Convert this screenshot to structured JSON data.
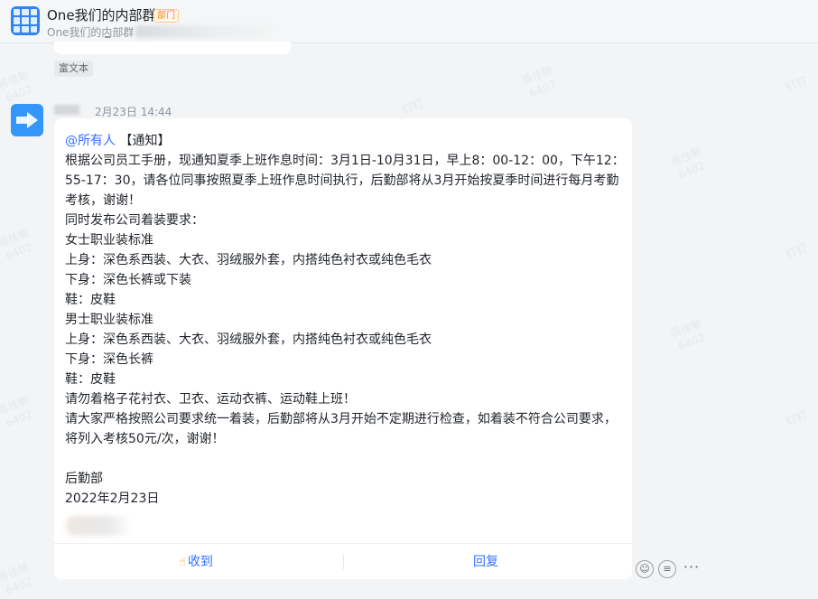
{
  "header": {
    "title": "One我们的内部群",
    "dept_tag": "部门",
    "subtitle": "One我们的内部群"
  },
  "prev_message": {
    "rich_text_tag": "富文本"
  },
  "message": {
    "time": "2月23日 14:44",
    "mention": "@所有人",
    "notice_title": "【通知】",
    "lines": [
      "根据公司员工手册，现通知夏季上班作息时间：3月1日-10月31日，早上8：00-12：00，下午12：",
      "55-17：30，请各位同事按照夏季上班作息时间执行，后勤部将从3月开始按夏季时间进行每月考勤",
      "考核，谢谢！",
      "同时发布公司着装要求：",
      "女士职业装标准",
      "上身：深色系西装、大衣、羽绒服外套，内搭纯色衬衣或纯色毛衣",
      "下身：深色长裤或下装",
      "鞋：皮鞋",
      "男士职业装标准",
      "上身：深色系西装、大衣、羽绒服外套，内搭纯色衬衣或纯色毛衣",
      "下身：深色长裤",
      "鞋：皮鞋",
      "请勿着格子花衬衣、卫衣、运动衣裤、运动鞋上班！",
      "请大家严格按照公司要求统一着装，后勤部将从3月开始不定期进行检查，如着装不符合公司要求，",
      "将列入考核50元/次，谢谢！"
    ],
    "signature_dept": "后勤部",
    "signature_date": "2022年2月23日"
  },
  "footer": {
    "ack_label": "收到",
    "reply_label": "回复"
  },
  "watermark": {
    "name": "蒋佳敏",
    "code": "6402",
    "app": "钉钉"
  },
  "colors": {
    "accent": "#3370ff",
    "dept_tag": "#ff8800",
    "avatar": "#3296fa"
  }
}
